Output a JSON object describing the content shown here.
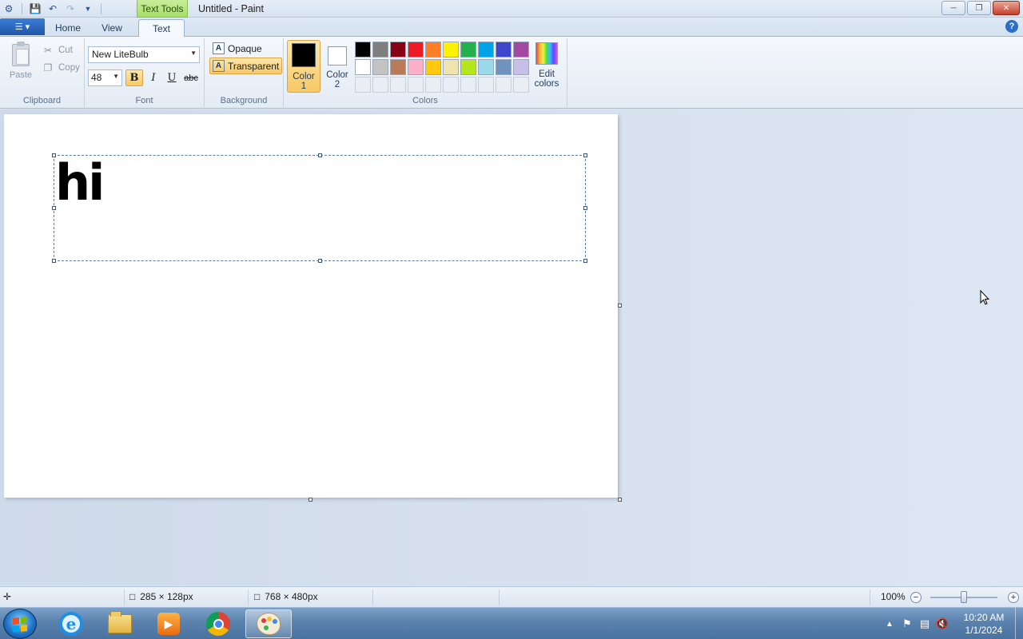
{
  "titlebar": {
    "contextual_tab": "Text Tools",
    "title": "Untitled - Paint"
  },
  "tabs": {
    "home": "Home",
    "view": "View",
    "text": "Text"
  },
  "ribbon": {
    "clipboard": {
      "label": "Clipboard",
      "paste": "Paste",
      "cut": "Cut",
      "copy": "Copy"
    },
    "font": {
      "label": "Font",
      "family": "New LiteBulb",
      "size": "48",
      "bold": "B",
      "italic": "I",
      "underline": "U",
      "strike": "abc"
    },
    "background": {
      "label": "Background",
      "opaque": "Opaque",
      "transparent": "Transparent"
    },
    "colors": {
      "label": "Colors",
      "color1_line1": "Color",
      "color1_line2": "1",
      "color2_line1": "Color",
      "color2_line2": "2",
      "color1_value": "#000000",
      "color2_value": "#ffffff",
      "edit_line1": "Edit",
      "edit_line2": "colors",
      "palette_row1": [
        "#000000",
        "#7f7f7f",
        "#880015",
        "#ed1c24",
        "#ff7f27",
        "#fff200",
        "#22b14c",
        "#00a2e8",
        "#3f48cc",
        "#a349a4"
      ],
      "palette_row2": [
        "#ffffff",
        "#c3c3c3",
        "#b97a57",
        "#ffaec9",
        "#ffc90e",
        "#efe4b0",
        "#b5e61d",
        "#99d9ea",
        "#7092be",
        "#c8bfe7"
      ]
    }
  },
  "canvas": {
    "text": "hi"
  },
  "statusbar": {
    "selection_size": "285 × 128px",
    "canvas_size": "768 × 480px",
    "zoom": "100%"
  },
  "taskbar": {
    "time": "10:20 AM",
    "date": "1/1/2024"
  }
}
